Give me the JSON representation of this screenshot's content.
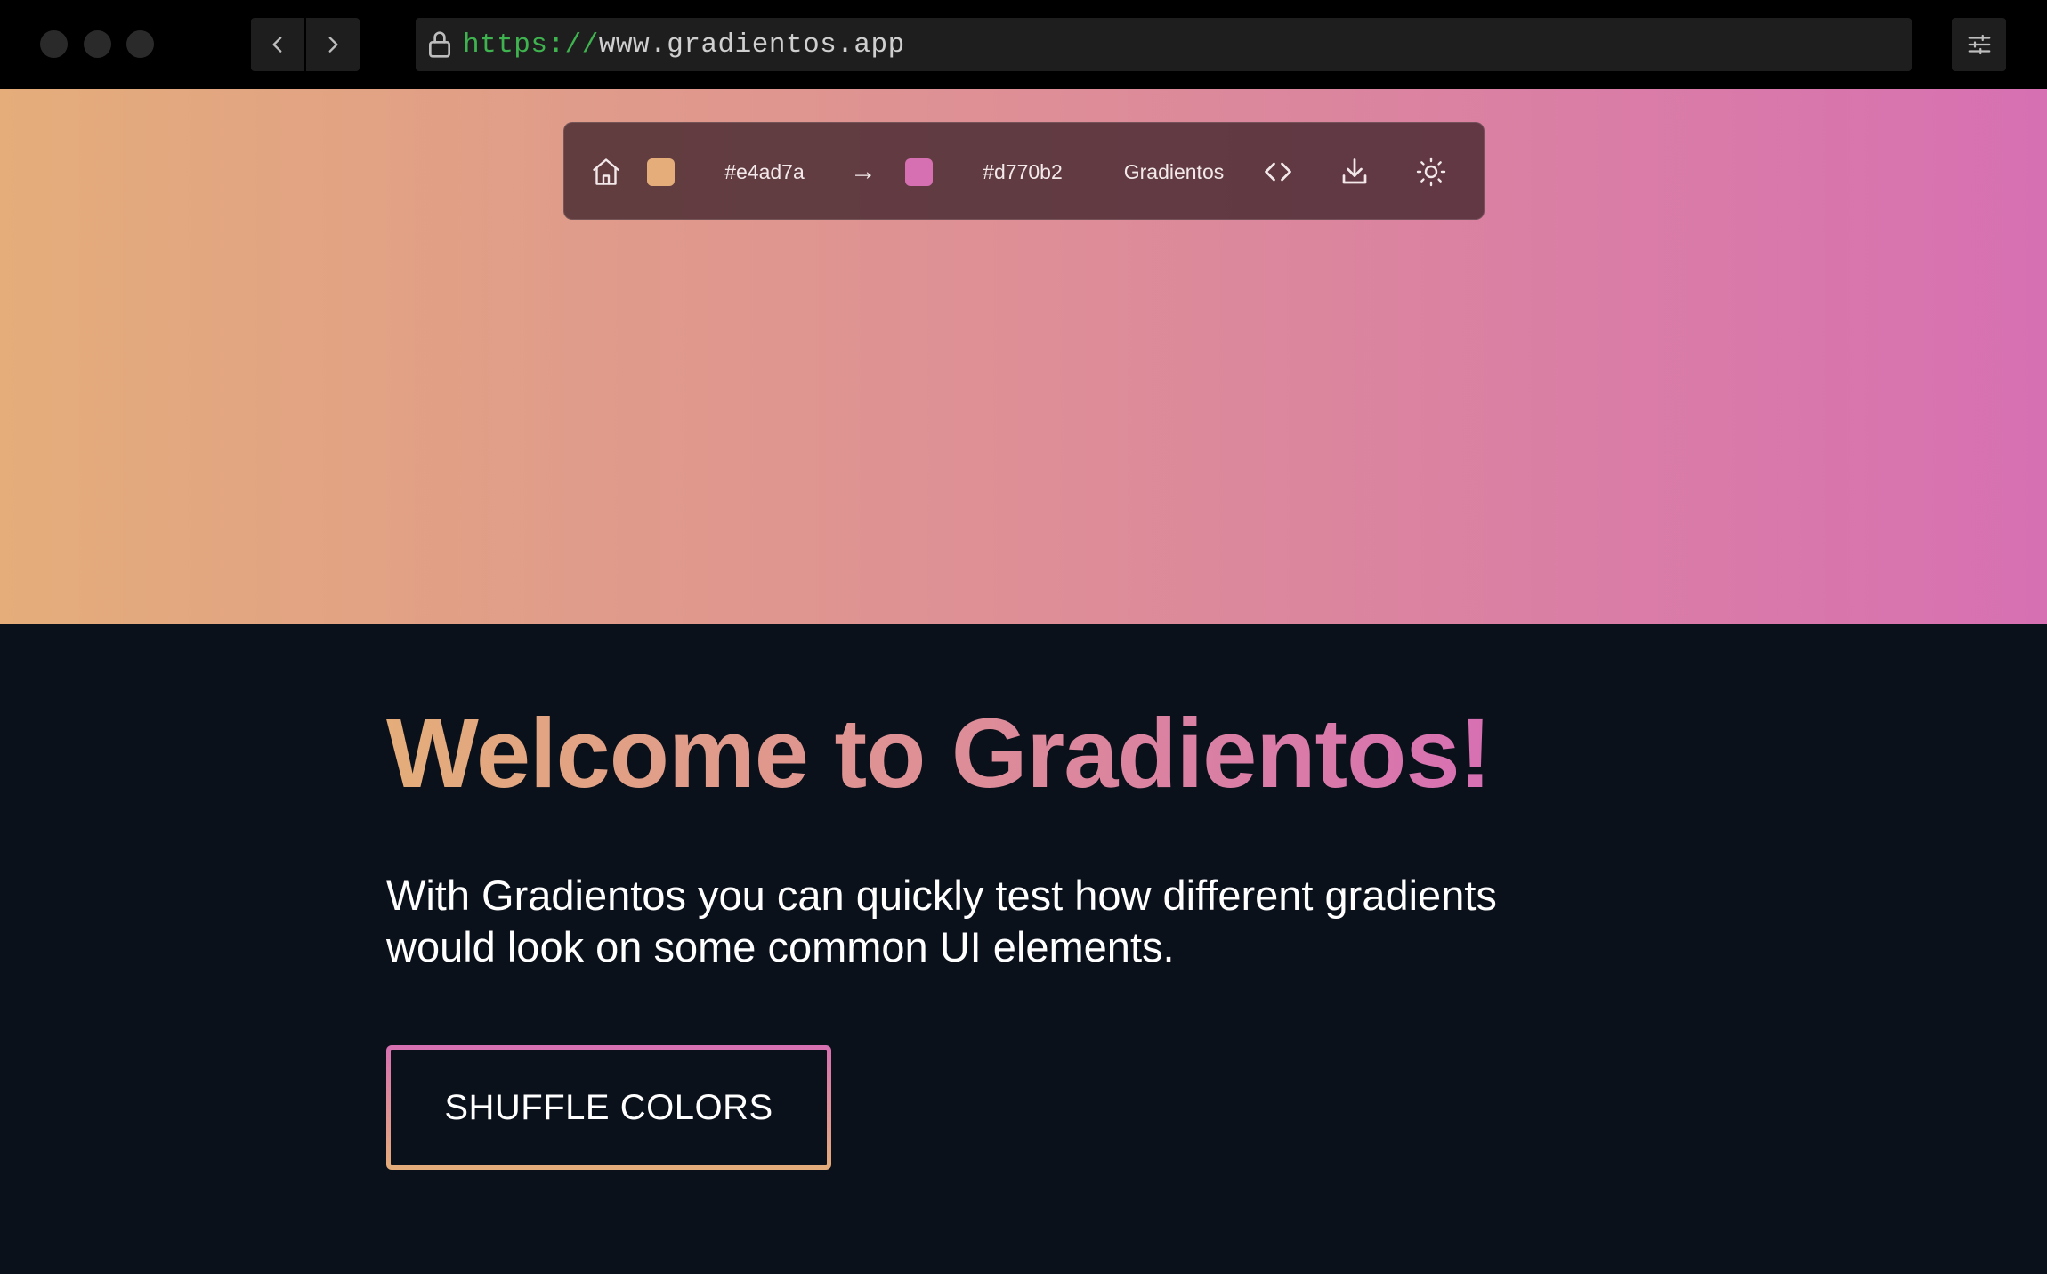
{
  "browser": {
    "url_protocol": "https://",
    "url_host": "www.gradientos.app",
    "icons": {
      "back": "chevron-left-icon",
      "forward": "chevron-right-icon",
      "lock": "lock-icon",
      "settings": "sliders-icon"
    }
  },
  "toolbar": {
    "color_from": "#e4ad7a",
    "arrow": "→",
    "color_to": "#d770b2",
    "brand_label": "Gradientos",
    "icons": {
      "home": "home-icon",
      "code": "code-icon",
      "download": "download-icon",
      "theme": "sun-icon"
    }
  },
  "main": {
    "title": "Welcome to Gradientos!",
    "description": "With Gradientos you can quickly test how different gradients would look on some common UI elements.",
    "shuffle_button": "SHUFFLE COLORS"
  },
  "colors": {
    "gradient_start": "#e4ad7a",
    "gradient_end": "#d770b2",
    "page_background": "#0b111b",
    "url_protocol_green": "#3fb34f"
  }
}
